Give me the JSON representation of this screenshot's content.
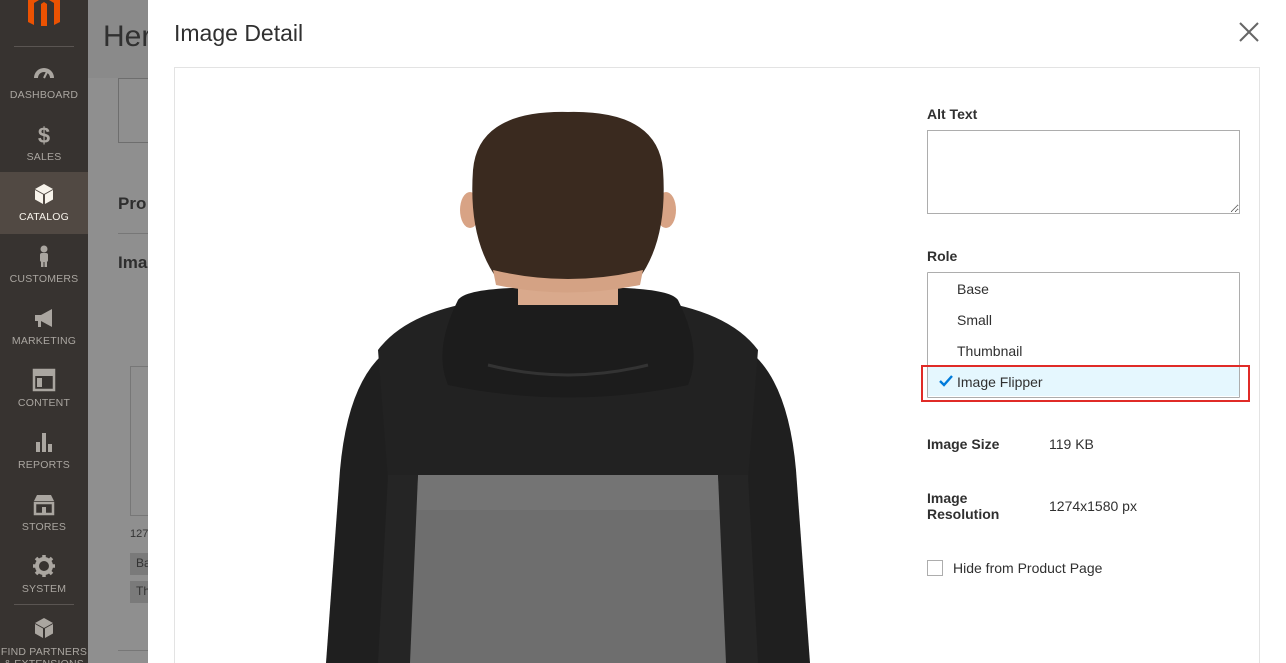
{
  "sidebar": {
    "items": [
      {
        "label": "Dashboard",
        "icon": "dashboard-icon"
      },
      {
        "label": "Sales",
        "icon": "dollar-icon"
      },
      {
        "label": "Catalog",
        "icon": "box-icon",
        "active": true
      },
      {
        "label": "Customers",
        "icon": "person-icon"
      },
      {
        "label": "Marketing",
        "icon": "megaphone-icon"
      },
      {
        "label": "Content",
        "icon": "layout-icon"
      },
      {
        "label": "Reports",
        "icon": "bar-chart-icon"
      },
      {
        "label": "Stores",
        "icon": "store-icon"
      },
      {
        "label": "System",
        "icon": "gear-icon"
      },
      {
        "label": "Find Partners & Extensions",
        "icon": "puzzle-box-icon"
      }
    ]
  },
  "background_page": {
    "title": "Her",
    "section1": "Pro",
    "section2": "Ima",
    "thumb_caption": "127",
    "tag1": "Ba",
    "tag2": "Th"
  },
  "modal": {
    "title": "Image Detail",
    "alt_text": {
      "label": "Alt Text",
      "value": ""
    },
    "role": {
      "label": "Role",
      "options": [
        {
          "label": "Base",
          "selected": false
        },
        {
          "label": "Small",
          "selected": false
        },
        {
          "label": "Thumbnail",
          "selected": false
        },
        {
          "label": "Image Flipper",
          "selected": true
        }
      ]
    },
    "image_size": {
      "label": "Image Size",
      "value": "119 KB"
    },
    "image_resolution": {
      "label_line1": "Image",
      "label_line2": "Resolution",
      "value": "1274x1580 px"
    },
    "hide_from_product_page": {
      "label": "Hide from Product Page",
      "checked": false
    }
  },
  "colors": {
    "sidebar_bg": "#373330",
    "sidebar_active": "#514943",
    "logo_orange": "#eb5202",
    "selected_option_bg": "#e5f7fe",
    "check_blue": "#007bdb",
    "highlight_red": "#e02b27"
  }
}
